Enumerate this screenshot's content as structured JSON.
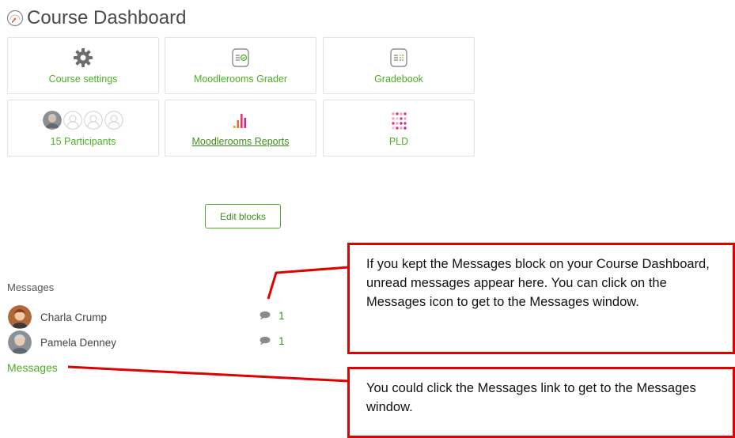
{
  "page": {
    "title": "Course Dashboard",
    "title_icon": "dashboard-gauge-icon"
  },
  "tiles": [
    {
      "id": "course-settings",
      "label": "Course settings",
      "icon": "gear-icon"
    },
    {
      "id": "moodlerooms-grader",
      "label": "Moodlerooms Grader",
      "icon": "grader-icon"
    },
    {
      "id": "gradebook",
      "label": "Gradebook",
      "icon": "gradebook-icon"
    },
    {
      "id": "participants",
      "label": "15 Participants",
      "icon": "participant-avatars"
    },
    {
      "id": "moodlerooms-reports",
      "label": "Moodlerooms Reports",
      "icon": "reports-bars-icon"
    },
    {
      "id": "pld",
      "label": "PLD",
      "icon": "pld-dots-icon"
    }
  ],
  "edit_blocks": {
    "label": "Edit blocks"
  },
  "messages": {
    "heading": "Messages",
    "items": [
      {
        "name": "Charla Crump",
        "count": "1",
        "icon": "speech-bubble-icon"
      },
      {
        "name": "Pamela Denney",
        "count": "1",
        "icon": "speech-bubble-icon"
      }
    ],
    "link_label": "Messages"
  },
  "callouts": {
    "unread": "If you kept the Messages block on your Course Dashboard, unread messages appear here. You can click on the Messages icon to get to the Messages window.",
    "link": "You could click the Messages link to get to the Messages window."
  },
  "colors": {
    "accent_green": "#4caf22",
    "callout_red": "#e00000",
    "text_gray": "#4a4a4a"
  }
}
